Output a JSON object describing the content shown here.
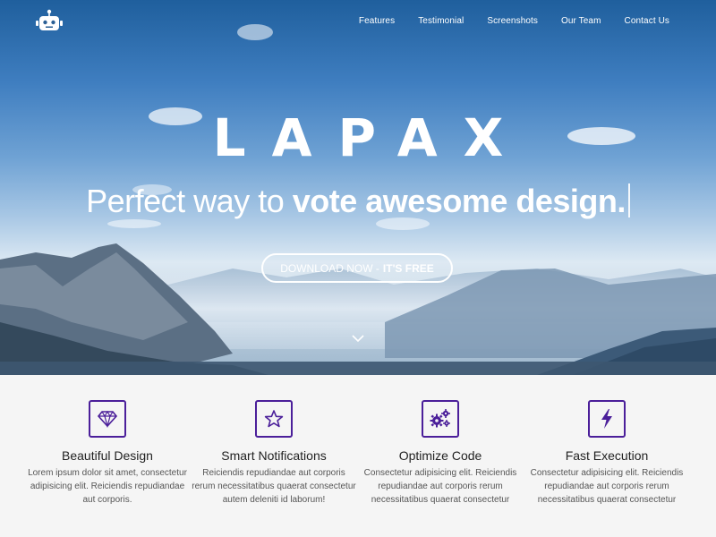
{
  "nav": {
    "items": [
      {
        "label": "Features"
      },
      {
        "label": "Testimonial"
      },
      {
        "label": "Screenshots"
      },
      {
        "label": "Our Team"
      },
      {
        "label": "Contact Us"
      }
    ]
  },
  "hero": {
    "brand": "LAPAX",
    "tagline_light": "Perfect way to ",
    "tagline_bold": "vote awesome design.",
    "cta_text": "DOWNLOAD NOW - ",
    "cta_emphasis": "IT'S FREE",
    "logo_icon": "robot-icon",
    "scroll_icon": "chevron-down-icon"
  },
  "features": [
    {
      "title": "Beautiful Design",
      "text": "Lorem ipsum dolor sit amet, consectetur adipisicing elit. Reiciendis repudiandae aut corporis.",
      "icon": "diamond-icon"
    },
    {
      "title": "Smart Notifications",
      "text": "Reiciendis repudiandae aut corporis rerum necessitatibus quaerat consectetur autem deleniti id laborum!",
      "icon": "star-icon"
    },
    {
      "title": "Optimize Code",
      "text": "Consectetur adipisicing elit. Reiciendis repudiandae aut corporis rerum necessitatibus quaerat consectetur",
      "icon": "gears-icon"
    },
    {
      "title": "Fast Execution",
      "text": "Consectetur adipisicing elit. Reiciendis repudiandae aut corporis rerum necessitatibus quaerat consectetur",
      "icon": "bolt-icon"
    }
  ],
  "colors": {
    "accent": "#4b1f9a",
    "hero_sky_top": "#1f5f9d",
    "text_dark": "#222222",
    "text_muted": "#555555",
    "section_bg": "#f5f5f5"
  }
}
